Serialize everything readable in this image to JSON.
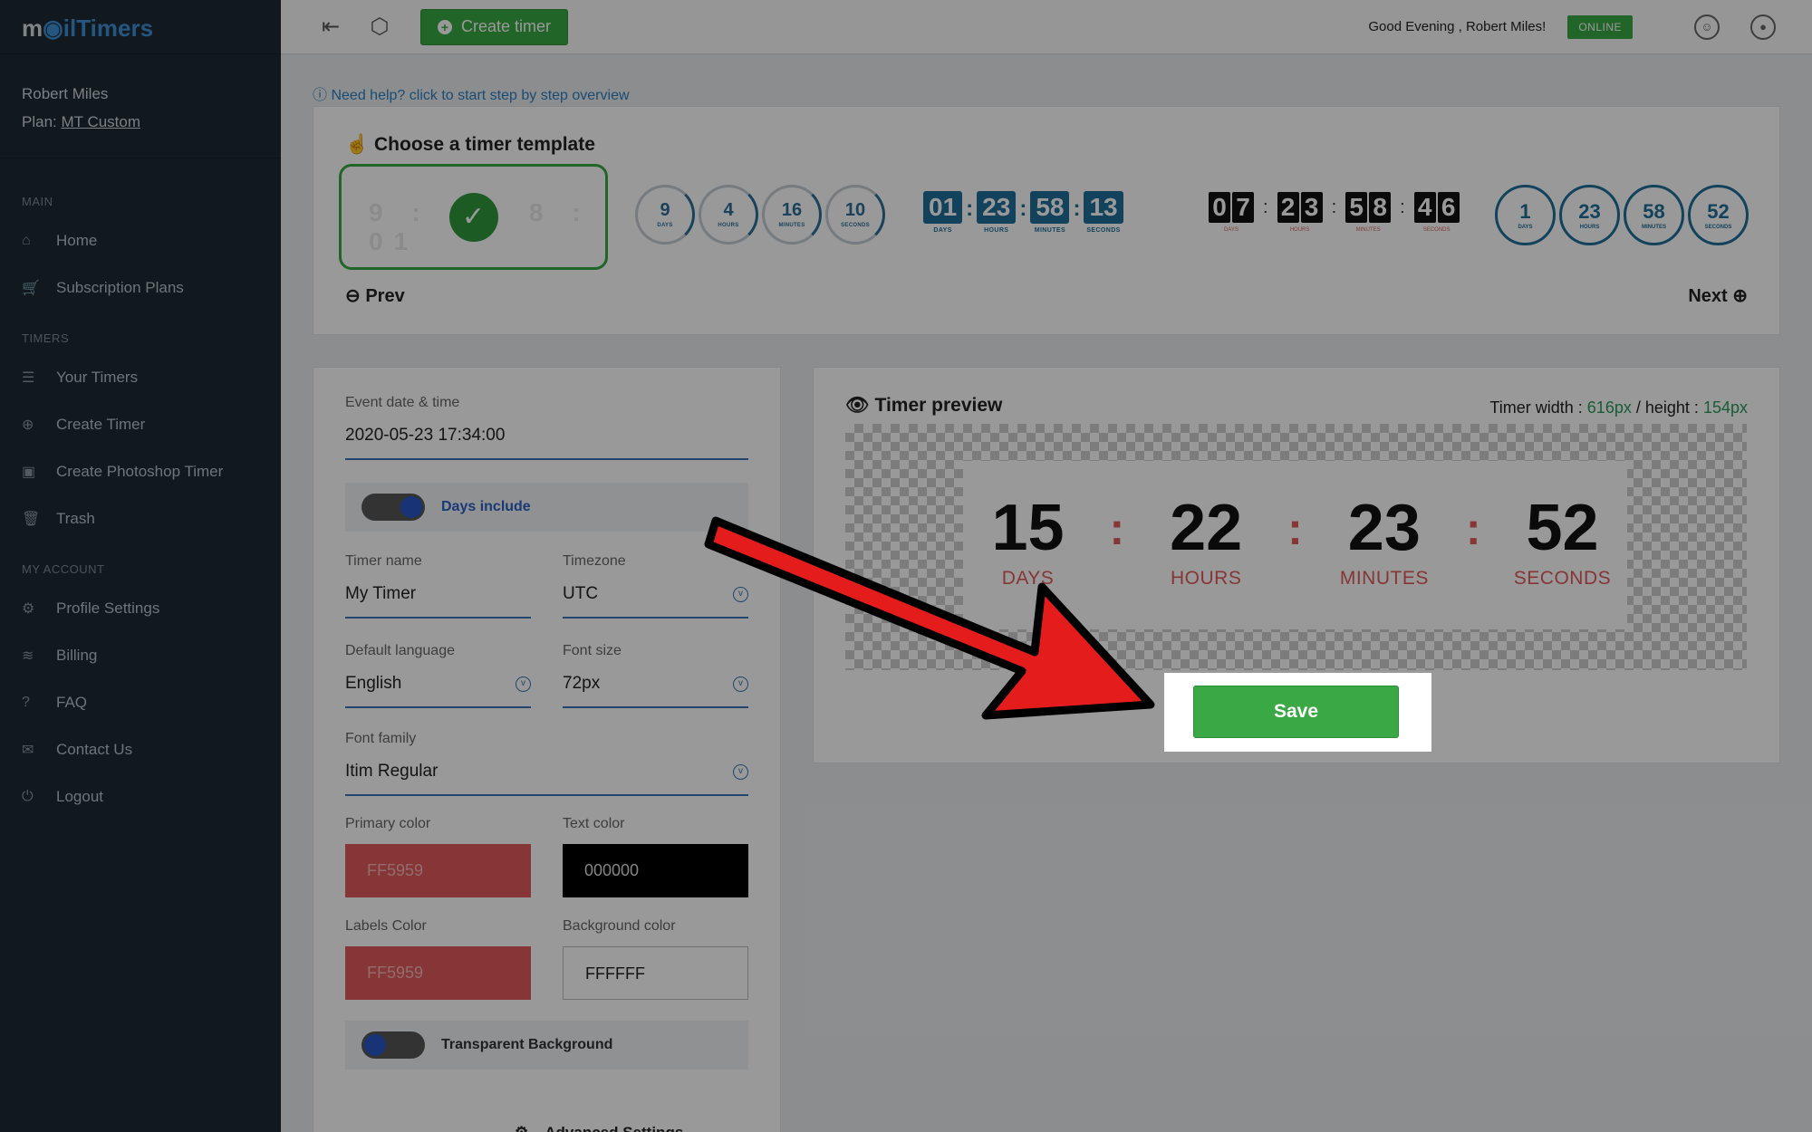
{
  "app": {
    "logo_left": "m",
    "logo_accent": "◉il",
    "logo_right": "Timers"
  },
  "user": {
    "name": "Robert Miles",
    "plan_label": "Plan:",
    "plan_value": "MT Custom"
  },
  "sidebar": {
    "sections": [
      {
        "title": "MAIN",
        "items": [
          {
            "label": "Home",
            "icon": "home-icon",
            "glyph": "⌂"
          },
          {
            "label": "Subscription Plans",
            "icon": "cart-icon",
            "glyph": "🛒"
          }
        ]
      },
      {
        "title": "TIMERS",
        "items": [
          {
            "label": "Your Timers",
            "icon": "list-icon",
            "glyph": "☰"
          },
          {
            "label": "Create Timer",
            "icon": "plus-circle-icon",
            "glyph": "⊕"
          },
          {
            "label": "Create Photoshop Timer",
            "icon": "photoshop-icon",
            "glyph": "▣"
          },
          {
            "label": "Trash",
            "icon": "trash-icon",
            "glyph": "🗑"
          }
        ]
      },
      {
        "title": "MY ACCOUNT",
        "items": [
          {
            "label": "Profile Settings",
            "icon": "gears-icon",
            "glyph": "⚙"
          },
          {
            "label": "Billing",
            "icon": "database-icon",
            "glyph": "≋"
          },
          {
            "label": "FAQ",
            "icon": "question-circle-icon",
            "glyph": "?"
          },
          {
            "label": "Contact Us",
            "icon": "envelope-icon",
            "glyph": "✉"
          },
          {
            "label": "Logout",
            "icon": "power-icon",
            "glyph": "⏻"
          }
        ]
      }
    ]
  },
  "topbar": {
    "create_label": "Create timer",
    "greeting": "Good Evening , Robert Miles!",
    "status": "ONLINE"
  },
  "help": {
    "text": "Need help? click to start step by step overview"
  },
  "templates": {
    "title": "Choose a timer template",
    "selected_ghost": "9 : 1 : 8 : 01",
    "circles_a": [
      {
        "value": "9",
        "label": "DAYS"
      },
      {
        "value": "4",
        "label": "HOURS"
      },
      {
        "value": "16",
        "label": "MINUTES"
      },
      {
        "value": "10",
        "label": "SECONDS"
      }
    ],
    "blocks": [
      {
        "value": "01",
        "label": "DAYS"
      },
      {
        "value": "23",
        "label": "HOURS"
      },
      {
        "value": "58",
        "label": "MINUTES"
      },
      {
        "value": "13",
        "label": "SECONDS"
      }
    ],
    "flip": [
      {
        "d1": "0",
        "d2": "7",
        "label": "DAYS"
      },
      {
        "d1": "2",
        "d2": "3",
        "label": "HOURS"
      },
      {
        "d1": "5",
        "d2": "8",
        "label": "MINUTES"
      },
      {
        "d1": "4",
        "d2": "6",
        "label": "SECONDS"
      }
    ],
    "circles_b": [
      {
        "value": "1",
        "label": "DAYS"
      },
      {
        "value": "23",
        "label": "HOURS"
      },
      {
        "value": "58",
        "label": "MINUTES"
      },
      {
        "value": "52",
        "label": "SECONDS"
      }
    ],
    "prev": "Prev",
    "next": "Next"
  },
  "form": {
    "event_label": "Event date & time",
    "event_value": "2020-05-23 17:34:00",
    "days_include": "Days include",
    "timer_name_label": "Timer name",
    "timer_name_value": "My Timer",
    "timezone_label": "Timezone",
    "timezone_value": "UTC",
    "language_label": "Default language",
    "language_value": "English",
    "font_size_label": "Font size",
    "font_size_value": "72px",
    "font_family_label": "Font family",
    "font_family_value": "Itim Regular",
    "primary_color_label": "Primary color",
    "primary_color_value": "FF5959",
    "text_color_label": "Text color",
    "text_color_value": "000000",
    "labels_color_label": "Labels Color",
    "labels_color_value": "FF5959",
    "bg_color_label": "Background color",
    "bg_color_value": "FFFFFF",
    "transparent_bg": "Transparent Background",
    "advanced": "Advanced Settings"
  },
  "preview": {
    "title": "Timer preview",
    "width_label": "Timer width :",
    "width_value": "616px",
    "separator": "/",
    "height_label": "height :",
    "height_value": "154px",
    "units": [
      {
        "value": "15",
        "label": "DAYS"
      },
      {
        "value": "22",
        "label": "HOURS"
      },
      {
        "value": "23",
        "label": "MINUTES"
      },
      {
        "value": "52",
        "label": "SECONDS"
      }
    ],
    "save_label": "Save"
  },
  "colors": {
    "accent_green": "#3aa845",
    "primary_red": "#FF5959",
    "sidebar_bg": "#1d2a33",
    "template_blue": "#1f6f99"
  }
}
